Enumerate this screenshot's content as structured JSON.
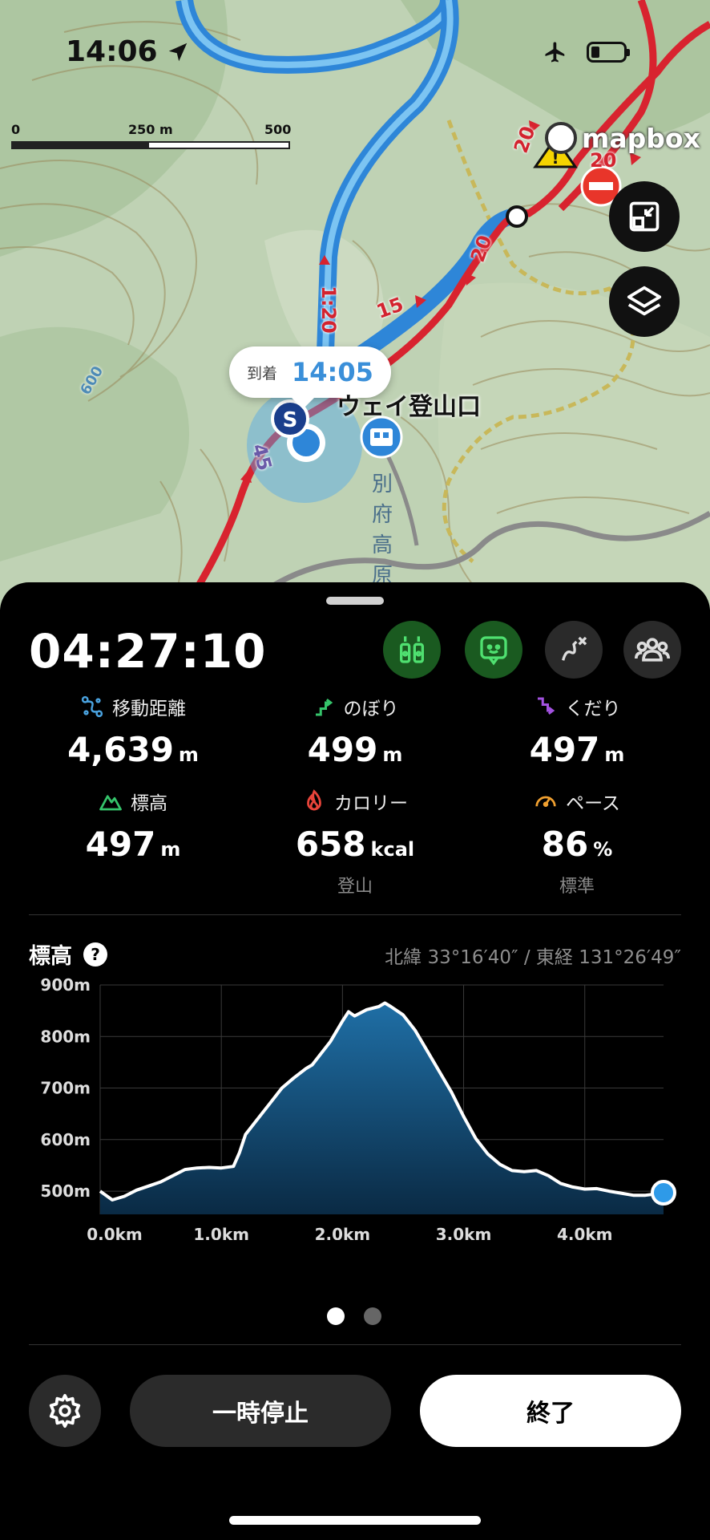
{
  "status": {
    "time": "14:06"
  },
  "map": {
    "scale_labels": [
      "0",
      "250 m",
      "500 m"
    ],
    "attribution": "mapbox",
    "arrival_label": "到着",
    "arrival_time": "14:05",
    "poi_name": "ウェイ登山口",
    "vertical_label": [
      "別",
      "府",
      "高",
      "原"
    ],
    "route_numbers": [
      {
        "text": "20",
        "color": "red"
      },
      {
        "text": "20",
        "color": "red"
      },
      {
        "text": "20",
        "color": "red"
      },
      {
        "text": "15",
        "color": "red"
      },
      {
        "text": "1:20",
        "color": "red"
      },
      {
        "text": "45",
        "color": "purple"
      }
    ],
    "contour_label": "600"
  },
  "panel": {
    "timer": "04:27:10",
    "stats": [
      {
        "label": "移動距離",
        "value": "4,639",
        "unit": "m",
        "sub": "",
        "icon": "route-icon",
        "color": "#4aa3e0"
      },
      {
        "label": "のぼり",
        "value": "499",
        "unit": "m",
        "sub": "",
        "icon": "ascent-icon",
        "color": "#35c46b"
      },
      {
        "label": "くだり",
        "value": "497",
        "unit": "m",
        "sub": "",
        "icon": "descent-icon",
        "color": "#a352e0"
      },
      {
        "label": "標高",
        "value": "497",
        "unit": "m",
        "sub": "",
        "icon": "mountain-icon",
        "color": "#35c46b"
      },
      {
        "label": "カロリー",
        "value": "658",
        "unit": "kcal",
        "sub": "登山",
        "icon": "flame-icon",
        "color": "#e8443a"
      },
      {
        "label": "ペース",
        "value": "86",
        "unit": "%",
        "sub": "標準",
        "icon": "speedometer-icon",
        "color": "#f0a030"
      }
    ],
    "elevation_title": "標高",
    "coordinates": "北緯 33°16′40″ / 東経 131°26′49″",
    "pause_label": "一時停止",
    "end_label": "終了"
  },
  "chart_data": {
    "type": "area",
    "ylabel_ticks": [
      "900m",
      "800m",
      "700m",
      "600m",
      "500m"
    ],
    "xlabel_ticks": [
      "0.0km",
      "1.0km",
      "2.0km",
      "3.0km",
      "4.0km"
    ],
    "ylim": [
      455,
      900
    ],
    "xlim": [
      0,
      4.65
    ],
    "x": [
      0,
      0.1,
      0.2,
      0.3,
      0.4,
      0.5,
      0.6,
      0.7,
      0.8,
      0.9,
      1.0,
      1.1,
      1.15,
      1.2,
      1.3,
      1.4,
      1.5,
      1.6,
      1.7,
      1.75,
      1.8,
      1.9,
      2.0,
      2.05,
      2.1,
      2.2,
      2.3,
      2.35,
      2.4,
      2.5,
      2.6,
      2.7,
      2.8,
      2.9,
      3.0,
      3.1,
      3.2,
      3.3,
      3.4,
      3.5,
      3.6,
      3.7,
      3.8,
      3.9,
      4.0,
      4.1,
      4.2,
      4.3,
      4.4,
      4.5,
      4.6,
      4.65
    ],
    "y": [
      500,
      483,
      490,
      502,
      510,
      518,
      530,
      542,
      545,
      546,
      545,
      548,
      575,
      610,
      640,
      670,
      700,
      720,
      738,
      745,
      760,
      790,
      830,
      848,
      840,
      852,
      858,
      865,
      858,
      842,
      812,
      772,
      732,
      692,
      645,
      602,
      572,
      552,
      540,
      538,
      540,
      530,
      515,
      508,
      504,
      505,
      500,
      496,
      492,
      492,
      495,
      497
    ],
    "grid": true,
    "current_position": {
      "x": 4.65,
      "y": 497
    }
  }
}
